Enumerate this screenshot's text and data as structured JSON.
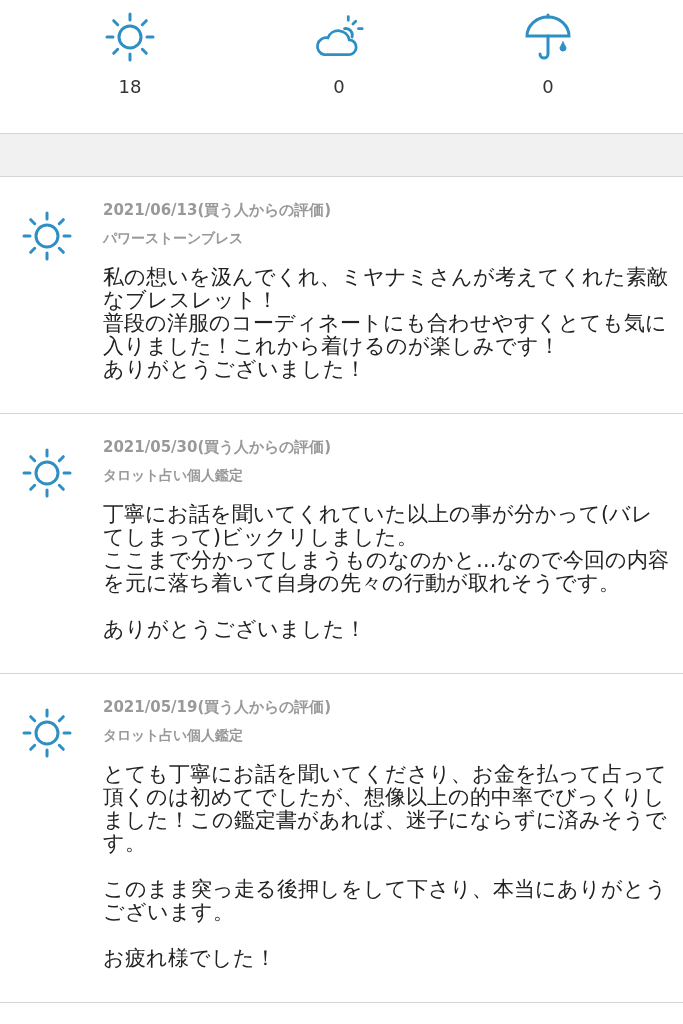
{
  "summary": [
    {
      "kind": "sunny",
      "count": "18"
    },
    {
      "kind": "cloudy",
      "count": "0"
    },
    {
      "kind": "rainy",
      "count": "0"
    }
  ],
  "reviews": [
    {
      "kind": "sunny",
      "date": "2021/06/13(買う人からの評価)",
      "title": "パワーストーンブレス",
      "paragraphs": [
        [
          "私の想いを汲んでくれ、ミヤナミさんが考えてくれた素敵なブレスレット！",
          "普段の洋服のコーディネートにも合わせやすくとても気に入りました！これから着けるのが楽しみです！",
          "ありがとうございました！"
        ]
      ]
    },
    {
      "kind": "sunny",
      "date": "2021/05/30(買う人からの評価)",
      "title": "タロット占い個人鑑定",
      "paragraphs": [
        [
          "丁寧にお話を聞いてくれていた以上の事が分かって(バレてしまって)ビックリしました。",
          "ここまで分かってしまうものなのかと…なので今回の内容を元に落ち着いて自身の先々の行動が取れそうです。"
        ],
        [
          "ありがとうございました！"
        ]
      ]
    },
    {
      "kind": "sunny",
      "date": "2021/05/19(買う人からの評価)",
      "title": "タロット占い個人鑑定",
      "paragraphs": [
        [
          "とても丁寧にお話を聞いてくださり、お金を払って占って頂くのは初めてでしたが、想像以上の的中率でびっくりしました！この鑑定書があれば、迷子にならずに済みそうです。"
        ],
        [
          "このまま突っ走る後押しをして下さり、本当にありがとうございます。"
        ],
        [
          "お疲れ様でした！"
        ]
      ]
    }
  ]
}
